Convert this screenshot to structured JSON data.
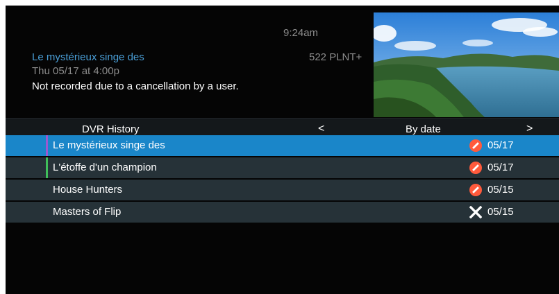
{
  "clock": "9:24am",
  "info": {
    "title": "Le mystérieux singe des",
    "time": "Thu 05/17 at 4:00p",
    "status": "Not recorded due to a cancellation by a user.",
    "channel": "522 PLNT+"
  },
  "list_header": {
    "title": "DVR History",
    "prev": "<",
    "sort": "By date",
    "next": ">"
  },
  "recordings": [
    {
      "title": "Le mystérieux singe des",
      "date": "05/17",
      "icon": "cancelled-icon",
      "accent": "#9b59d0"
    },
    {
      "title": "L'étoffe d'un champion",
      "date": "05/17",
      "icon": "cancelled-icon",
      "accent": "#3fbf5a"
    },
    {
      "title": "House Hunters",
      "date": "05/15",
      "icon": "cancelled-icon",
      "accent": ""
    },
    {
      "title": "Masters of Flip",
      "date": "05/15",
      "icon": "failed-x-icon",
      "accent": ""
    }
  ],
  "colors": {
    "selection": "#1a86c9",
    "row": "#263238",
    "info_title": "#4a9fd8",
    "cancel_icon": "#ff5a3c"
  }
}
